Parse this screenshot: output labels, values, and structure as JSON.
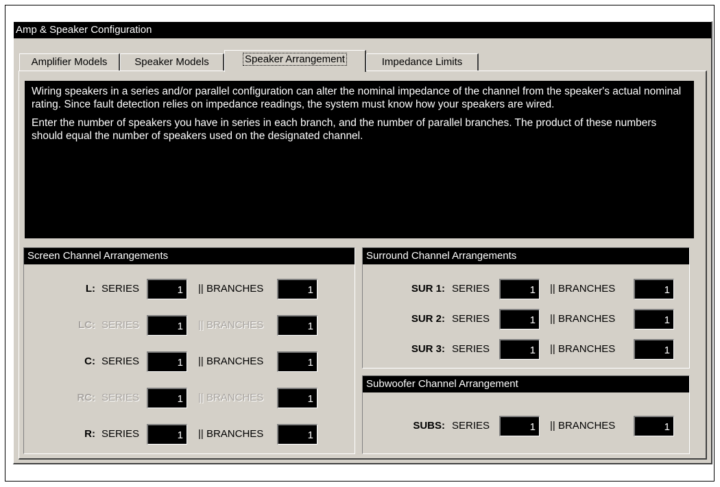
{
  "window": {
    "title": "Amp & Speaker Configuration"
  },
  "tabs": [
    {
      "label": "Amplifier Models",
      "active": false
    },
    {
      "label": "Speaker Models",
      "active": false
    },
    {
      "label": "Speaker Arrangement",
      "active": true
    },
    {
      "label": "Impedance Limits",
      "active": false
    }
  ],
  "info": {
    "paragraph1": "Wiring speakers in a series and/or parallel configuration can alter the nominal impedance of the channel from the speaker's actual nominal rating.  Since fault detection relies on impedance readings, the system must know how your speakers are wired.",
    "paragraph2": "Enter the number of speakers you have in series in each branch, and the number of parallel branches.  The product of these numbers should equal the number of speakers used on the designated channel."
  },
  "screen": {
    "title": "Screen Channel Arrangements",
    "rows": [
      {
        "label": "L:",
        "series_label": "SERIES",
        "series": "1",
        "branches_label": "|| BRANCHES",
        "branches": "1",
        "enabled": true
      },
      {
        "label": "LC:",
        "series_label": "SERIES",
        "series": "1",
        "branches_label": "|| BRANCHES",
        "branches": "1",
        "enabled": false
      },
      {
        "label": "C:",
        "series_label": "SERIES",
        "series": "1",
        "branches_label": "|| BRANCHES",
        "branches": "1",
        "enabled": true
      },
      {
        "label": "RC:",
        "series_label": "SERIES",
        "series": "1",
        "branches_label": "|| BRANCHES",
        "branches": "1",
        "enabled": false
      },
      {
        "label": "R:",
        "series_label": "SERIES",
        "series": "1",
        "branches_label": "|| BRANCHES",
        "branches": "1",
        "enabled": true
      }
    ]
  },
  "surround": {
    "title": "Surround Channel Arrangements",
    "rows": [
      {
        "label": "SUR 1:",
        "series_label": "SERIES",
        "series": "1",
        "branches_label": "|| BRANCHES",
        "branches": "1"
      },
      {
        "label": "SUR 2:",
        "series_label": "SERIES",
        "series": "1",
        "branches_label": "|| BRANCHES",
        "branches": "1"
      },
      {
        "label": "SUR 3:",
        "series_label": "SERIES",
        "series": "1",
        "branches_label": "|| BRANCHES",
        "branches": "1"
      }
    ]
  },
  "subwoofer": {
    "title": "Subwoofer Channel Arrangement",
    "rows": [
      {
        "label": "SUBS:",
        "series_label": "SERIES",
        "series": "1",
        "branches_label": "|| BRANCHES",
        "branches": "1"
      }
    ]
  },
  "colors": {
    "dialog_bg": "#d4d0c8",
    "header_bg": "#000000",
    "header_text": "#ffffff",
    "disabled_text": "#a8a4a0"
  }
}
